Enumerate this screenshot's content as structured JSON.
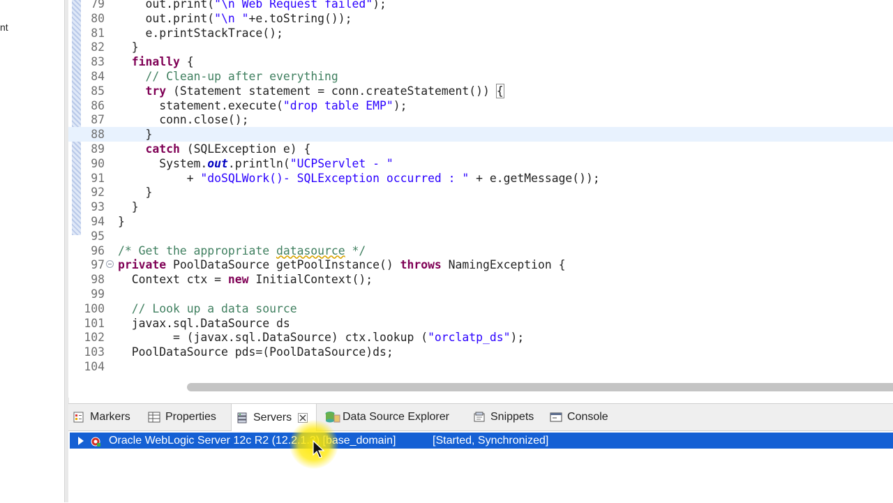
{
  "left_panel": {
    "fragment": "nt"
  },
  "editor": {
    "lines": [
      {
        "n": "79",
        "parts": [
          [
            "    out.print(",
            ""
          ],
          [
            "\"\\n Web Request failed\"",
            "str"
          ],
          [
            ");",
            ""
          ]
        ]
      },
      {
        "n": "80",
        "parts": [
          [
            "    out.print(",
            ""
          ],
          [
            "\"\\n \"",
            "str"
          ],
          [
            "+e.toString());",
            ""
          ]
        ]
      },
      {
        "n": "81",
        "parts": [
          [
            "    e.printStackTrace();",
            ""
          ]
        ]
      },
      {
        "n": "82",
        "parts": [
          [
            "  }",
            ""
          ]
        ]
      },
      {
        "n": "83",
        "parts": [
          [
            "  ",
            ""
          ],
          [
            "finally",
            "kw"
          ],
          [
            " {",
            ""
          ]
        ]
      },
      {
        "n": "84",
        "parts": [
          [
            "    ",
            ""
          ],
          [
            "// Clean-up after everything",
            "cm"
          ]
        ]
      },
      {
        "n": "85",
        "parts": [
          [
            "    ",
            ""
          ],
          [
            "try",
            "kw"
          ],
          [
            " (Statement statement = conn.createStatement()) ",
            ""
          ],
          [
            "{",
            "bracket"
          ]
        ]
      },
      {
        "n": "86",
        "parts": [
          [
            "      statement.execute(",
            ""
          ],
          [
            "\"drop table EMP\"",
            "str"
          ],
          [
            ");",
            ""
          ]
        ]
      },
      {
        "n": "87",
        "parts": [
          [
            "      conn.close();",
            ""
          ]
        ]
      },
      {
        "n": "88",
        "parts": [
          [
            "    }",
            ""
          ]
        ],
        "current": true
      },
      {
        "n": "89",
        "parts": [
          [
            "    ",
            ""
          ],
          [
            "catch",
            "kw"
          ],
          [
            " (SQLException e) {",
            ""
          ]
        ]
      },
      {
        "n": "90",
        "parts": [
          [
            "      System.",
            ""
          ],
          [
            "out",
            "fld"
          ],
          [
            ".println(",
            ""
          ],
          [
            "\"UCPServlet - \"",
            "str"
          ]
        ]
      },
      {
        "n": "91",
        "parts": [
          [
            "          + ",
            ""
          ],
          [
            "\"doSQLWork()- SQLException occurred : \"",
            "str"
          ],
          [
            " + e.getMessage());",
            ""
          ]
        ]
      },
      {
        "n": "92",
        "parts": [
          [
            "    }",
            ""
          ]
        ]
      },
      {
        "n": "93",
        "parts": [
          [
            "  }",
            ""
          ]
        ]
      },
      {
        "n": "94",
        "parts": [
          [
            "}",
            ""
          ]
        ]
      },
      {
        "n": "95",
        "parts": []
      },
      {
        "n": "96",
        "parts": [
          [
            "/* Get the appropriate ",
            "cm"
          ],
          [
            "datasource",
            "cm warn"
          ],
          [
            " */",
            "cm"
          ]
        ]
      },
      {
        "n": "97",
        "parts": [
          [
            "private",
            "kw"
          ],
          [
            " PoolDataSource getPoolInstance() ",
            ""
          ],
          [
            "throws",
            "kw"
          ],
          [
            " NamingException {",
            ""
          ]
        ],
        "fold": true
      },
      {
        "n": "98",
        "parts": [
          [
            "  Context ctx = ",
            ""
          ],
          [
            "new",
            "kw"
          ],
          [
            " InitialContext();",
            ""
          ]
        ]
      },
      {
        "n": "99",
        "parts": []
      },
      {
        "n": "100",
        "parts": [
          [
            "  ",
            ""
          ],
          [
            "// Look up a data source",
            "cm"
          ]
        ]
      },
      {
        "n": "101",
        "parts": [
          [
            "  javax.sql.DataSource ds",
            ""
          ]
        ]
      },
      {
        "n": "102",
        "parts": [
          [
            "        = (javax.sql.DataSource) ctx.lookup (",
            ""
          ],
          [
            "\"orclatp_ds\"",
            "str"
          ],
          [
            ");",
            ""
          ]
        ]
      },
      {
        "n": "103",
        "parts": [
          [
            "  PoolDataSource pds=(PoolDataSource)ds;",
            ""
          ]
        ]
      },
      {
        "n": "104",
        "parts": []
      }
    ]
  },
  "bottom": {
    "tabs": [
      {
        "label": "Markers",
        "icon": "markers-icon"
      },
      {
        "label": "Properties",
        "icon": "properties-icon"
      },
      {
        "label": "Servers",
        "icon": "servers-icon"
      },
      {
        "label": "Data Source Explorer",
        "icon": "data-source-explorer-icon"
      },
      {
        "label": "Snippets",
        "icon": "snippets-icon"
      },
      {
        "label": "Console",
        "icon": "console-icon"
      }
    ],
    "active_tab": "Servers",
    "server": {
      "name": "Oracle WebLogic Server 12c R2 (12.2.1.3) [base_domain]",
      "status": "[Started, Synchronized]"
    }
  },
  "colors": {
    "selection": "#1560d4",
    "keyword": "#7f0055",
    "string": "#2a00ff",
    "comment": "#3f7f5f",
    "current_line": "#e8f2fe",
    "cursor_highlight": "#ffe800"
  }
}
